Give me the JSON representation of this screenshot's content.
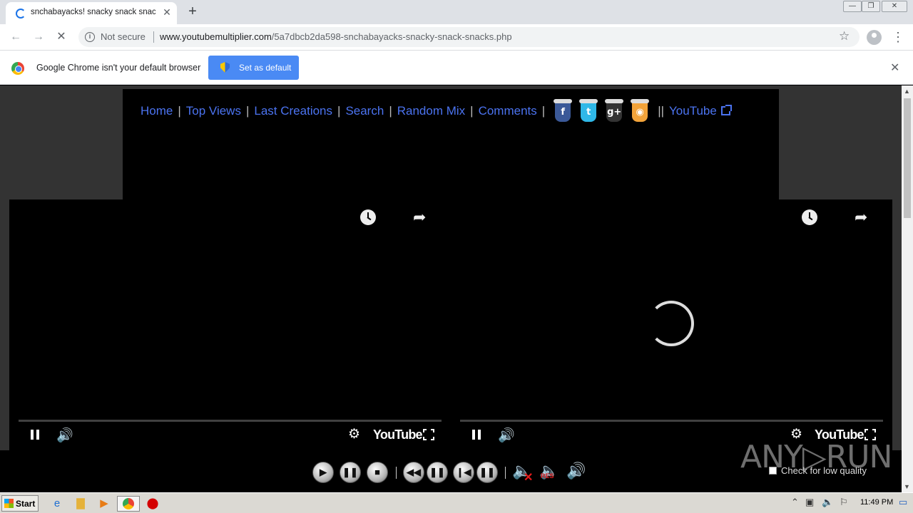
{
  "browser": {
    "tab_title": "snchabayacks! snacky snack snacks",
    "tab_close": "✕",
    "new_tab": "+",
    "window_controls": [
      "—",
      "❐",
      "✕"
    ],
    "not_secure": "Not secure",
    "url_host": "www.youtubemultiplier.com",
    "url_path": "/5a7dbcb2da598-snchabayacks-snacky-snack-snacks.php",
    "back_icon": "arrow-left-icon",
    "forward_icon": "arrow-right-icon",
    "reload_icon": "stop-loading-icon",
    "star_icon": "star-icon",
    "menu_icon": "kebab-menu-icon"
  },
  "infobar": {
    "message": "Google Chrome isn't your default browser",
    "button_label": "Set as default",
    "button_color": "#4a8af4",
    "close": "✕"
  },
  "page": {
    "nav": {
      "home": "Home",
      "top_views": "Top Views",
      "last_creations": "Last Creations",
      "search": "Search",
      "random_mix": "Random Mix",
      "comments": "Comments",
      "youtube": "YouTube",
      "separator": "|",
      "double_separator": "||"
    },
    "social": [
      {
        "name": "facebook-icon",
        "glyph": "f",
        "color": "#3b5998"
      },
      {
        "name": "twitter-icon",
        "glyph": "t",
        "color": "#2fb8e8"
      },
      {
        "name": "google-plus-icon",
        "glyph": "g+",
        "color": "#333333"
      },
      {
        "name": "rss-icon",
        "glyph": "◉",
        "color": "#f2a33a"
      }
    ],
    "accent_link_color": "#4b73f0",
    "players": [
      {
        "loading": false,
        "brand": "YouTube"
      },
      {
        "loading": true,
        "brand": "YouTube"
      }
    ],
    "controls": {
      "low_quality_label": "Check for low quality",
      "watermark": "ANY▷RUN"
    }
  },
  "taskbar": {
    "start_label": "Start",
    "clock": "11:49 PM"
  }
}
